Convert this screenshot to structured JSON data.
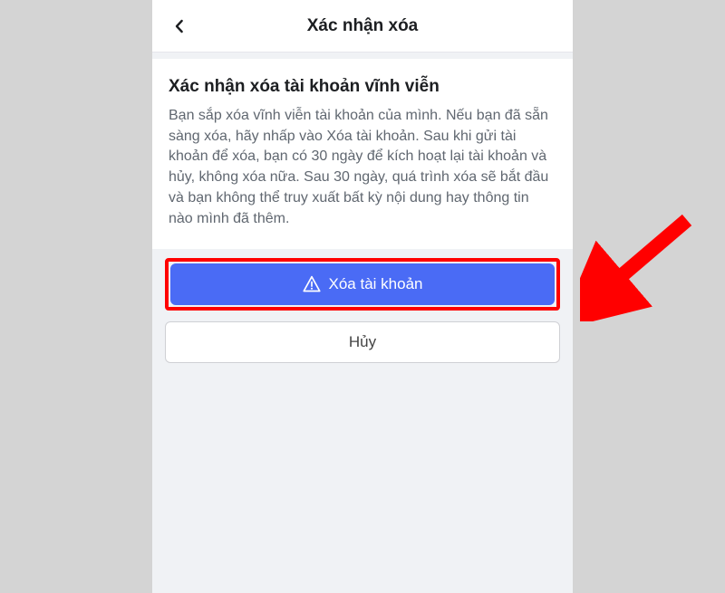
{
  "header": {
    "title": "Xác nhận xóa"
  },
  "card": {
    "title": "Xác nhận xóa tài khoản vĩnh viễn",
    "body": "Bạn sắp xóa vĩnh viễn tài khoản của mình. Nếu bạn đã sẵn sàng xóa, hãy nhấp vào Xóa tài khoản. Sau khi gửi tài khoản để xóa, bạn có 30 ngày để kích hoạt lại tài khoản và hủy, không xóa nữa. Sau 30 ngày, quá trình xóa sẽ bắt đầu và bạn không thể truy xuất bất kỳ nội dung hay thông tin nào mình đã thêm."
  },
  "buttons": {
    "delete_label": "Xóa tài khoản",
    "cancel_label": "Hủy"
  },
  "colors": {
    "primary": "#4A6BF5",
    "highlight_border": "#FF0000",
    "arrow": "#FF0000"
  }
}
